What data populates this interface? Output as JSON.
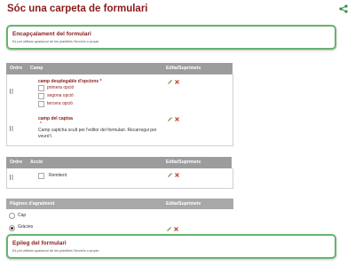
{
  "page": {
    "title": "Sóc una carpeta de formulari"
  },
  "header_box": {
    "title": "Encapçalament del formulari",
    "desc": "Es pot utilitzar qualsevol de les plantilles Servei/s o propis"
  },
  "fields_table": {
    "col_order": "Ordre",
    "col_field": "Camp",
    "col_edit": "Edita/Suprimeix",
    "fields": [
      {
        "label": "camp desplegable d'opcions",
        "required": "*",
        "options": [
          "primera opció",
          "segona opció",
          "tercera opció"
        ]
      },
      {
        "label": "camp del captxa",
        "required": "*",
        "help": "Camp captcha ocult per l'editor del formulari. Recarregui per veure'l."
      }
    ]
  },
  "actions_table": {
    "col_order": "Ordre",
    "col_action": "Acció",
    "col_edit": "Edita/Suprimeix",
    "actions": [
      {
        "label": "Remitent"
      }
    ]
  },
  "thanks_table": {
    "col_pages": "Pàgines d'agraïment",
    "col_edit": "Edita/Suprimeix",
    "options": [
      {
        "label": "Cap",
        "selected": false
      },
      {
        "label": "Gràcies",
        "selected": true
      }
    ]
  },
  "footer_box": {
    "title": "Epileg del formulari",
    "desc": "Es pot utilitzar qualsevol de les plantilles Servei/s o propis"
  },
  "colors": {
    "accent": "#8b1a1a",
    "green": "#67b46c",
    "header": "#9c9c9c"
  },
  "icons": [
    "share-icon",
    "drag-handle-icon",
    "pencil-icon",
    "delete-x-icon"
  ]
}
